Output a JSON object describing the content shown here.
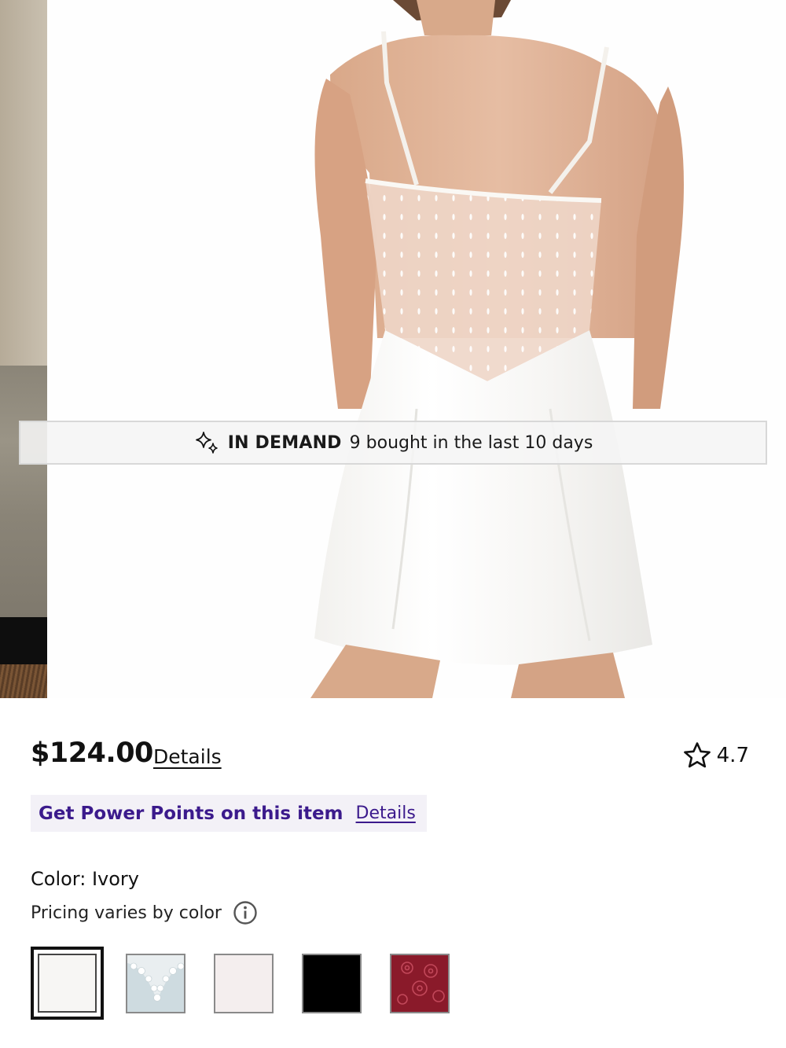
{
  "gallery": {
    "current_image_alt": "White satin chemise with sheer dotted mesh back",
    "banner": {
      "icon": "sparkle-icon",
      "label": "IN DEMAND",
      "text": "9 bought in the last 10 days"
    }
  },
  "product": {
    "price": "$124.00",
    "price_details_link": "Details",
    "rating": {
      "icon": "star-outline-icon",
      "value": "4.7"
    },
    "points": {
      "text": "Get Power Points on this item",
      "details_link": "Details"
    },
    "color_label": "Color: Ivory",
    "pricing_note": "Pricing varies by color",
    "info_icon": "info-circle-icon",
    "swatches": [
      {
        "name": "Ivory",
        "color": "#f7f6f4",
        "selected": true
      },
      {
        "name": "Light blue lace",
        "color": "#cfdde0",
        "selected": false
      },
      {
        "name": "Blush",
        "color": "#f4eeee",
        "selected": false
      },
      {
        "name": "Black",
        "color": "#000000",
        "selected": false
      },
      {
        "name": "Burgundy floral",
        "color": "#8b1a2b",
        "selected": false
      }
    ]
  },
  "colors": {
    "points_purple": "#3b1a8c",
    "points_bg": "#f3f1f7",
    "text": "#111111"
  }
}
